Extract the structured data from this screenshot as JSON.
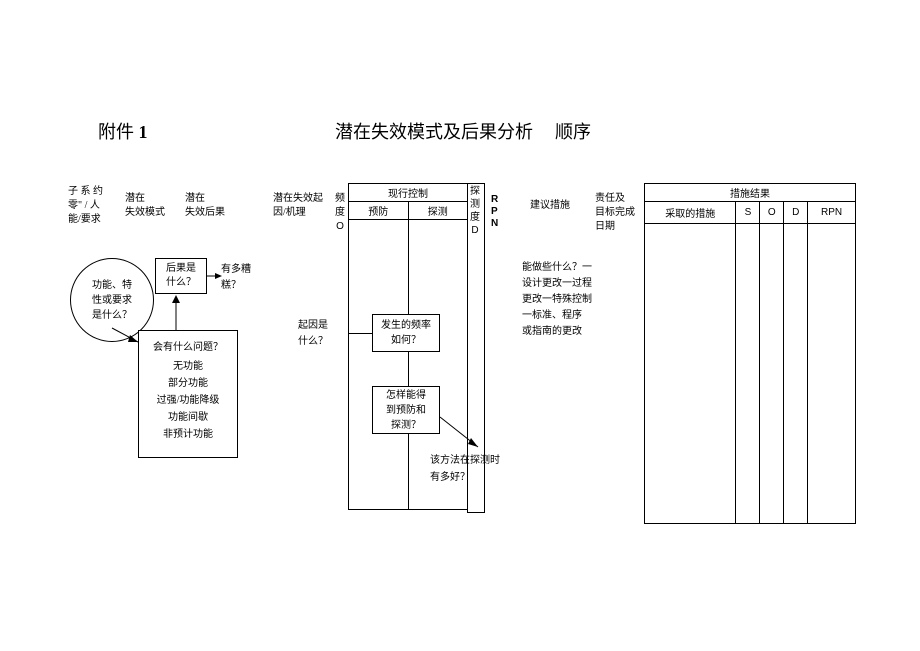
{
  "title": {
    "attachment": "附件",
    "num": "1",
    "main": "潜在失效模式及后果分析",
    "order": "顺序"
  },
  "headers": {
    "h1a": "子 系 约",
    "h1b": "零\"  /  人",
    "h1c": "能/要求",
    "h2a": "潜在",
    "h2b": "失效模式",
    "h3a": "潜在",
    "h3b": "失效后果",
    "h5a": "潜在失效起",
    "h5b": "因/机理",
    "h6a": "频",
    "h6b": "度",
    "h6c": "O",
    "h7": "现行控制",
    "h7a": "预防",
    "h7b": "探测",
    "h8a": "探",
    "h8b": "测",
    "h8c": "度",
    "h8d": "D",
    "h9a": "R",
    "h9b": "P",
    "h9c": "N",
    "h10": "建议措施",
    "h11a": "责任及",
    "h11b": "目标完成",
    "h11c": "日期",
    "h12": "措施结果",
    "h12a": "采取的措施",
    "h12s": "S",
    "h12o": "O",
    "h12d": "D",
    "h12r": "RPN"
  },
  "flow": {
    "circle": "功能、特\n性或要求\n是什么？",
    "box1": "后果是\n什么？",
    "howBad": "有多糟\n糕？",
    "box2_q": "会有什么问题？",
    "box2_items": [
      "无功能",
      "部分功能",
      "过强/功能降级",
      "功能间歇",
      "非预计功能"
    ],
    "cause": "起因是\n什么？",
    "freq": "发生的频率\n如何？",
    "detect": "怎样能得\n到预防和\n探测？",
    "goodness": "该方法在探测时\n有多好？",
    "whatCanDo": "能做些什么？一\n设计更改一过程\n更改一特殊控制\n一标准、程序\n或指南的更改"
  }
}
